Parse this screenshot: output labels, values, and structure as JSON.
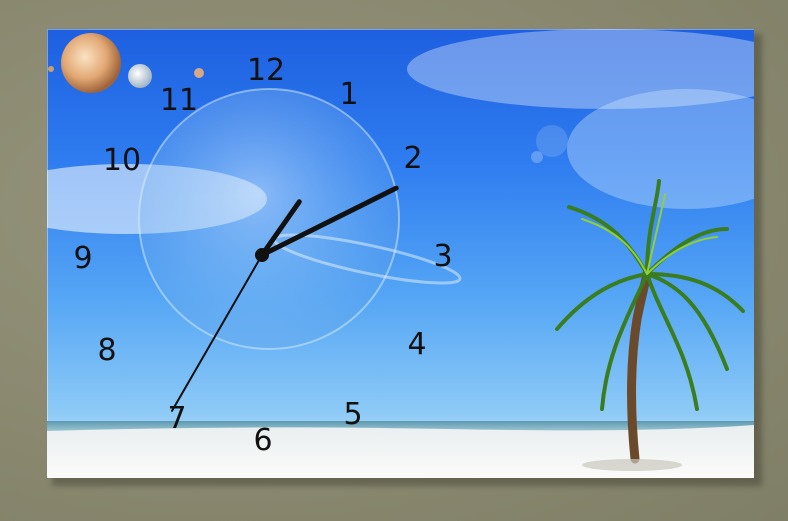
{
  "clock": {
    "numerals": {
      "n12": "12",
      "n1": "1",
      "n2": "2",
      "n3": "3",
      "n4": "4",
      "n5": "5",
      "n6": "6",
      "n7": "7",
      "n8": "8",
      "n9": "9",
      "n10": "10",
      "n11": "11"
    },
    "time_shown": {
      "hour": 1,
      "minute": 10,
      "second": 35
    },
    "hand_color": "#111111"
  },
  "colors": {
    "sky_top": "#1d5fe0",
    "sky_bottom": "#8cc9f6",
    "sand": "#f4f4f2",
    "sea": "#6fa7b8",
    "wall": "#8b8a72"
  }
}
